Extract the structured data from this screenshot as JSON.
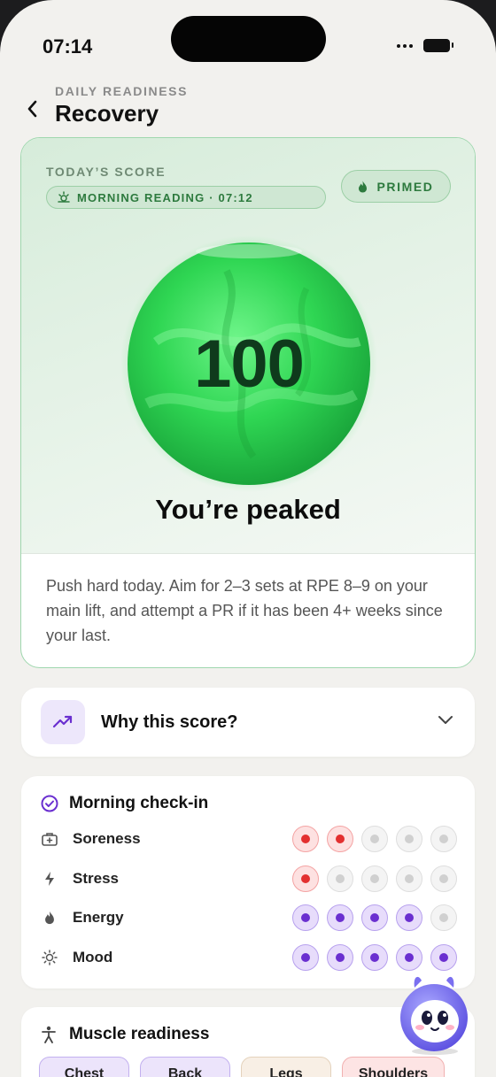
{
  "status": {
    "time": "07:14"
  },
  "header": {
    "eyebrow": "DAILY READINESS",
    "title": "Recovery"
  },
  "score_card": {
    "label": "TODAY’S SCORE",
    "reading_pill": "MORNING READING · 07:12",
    "badge": "PRIMED",
    "score": "100",
    "headline": "You’re peaked",
    "advice": "Push hard today. Aim for 2–3 sets at RPE 8–9 on your main lift, and attempt a PR if it has been 4+ weeks since your last.",
    "accent_color": "#2d7a3e",
    "orb_color": "#3ddb5c"
  },
  "why_card": {
    "title": "Why this score?",
    "icon": "trend-up-icon",
    "expanded": false
  },
  "checkin": {
    "title": "Morning check-in",
    "metrics": [
      {
        "label": "Soreness",
        "icon": "first-aid-icon",
        "level": 2,
        "max": 5,
        "tone": "red"
      },
      {
        "label": "Stress",
        "icon": "bolt-icon",
        "level": 1,
        "max": 5,
        "tone": "red"
      },
      {
        "label": "Energy",
        "icon": "flame-icon",
        "level": 4,
        "max": 5,
        "tone": "purple"
      },
      {
        "label": "Mood",
        "icon": "sun-icon",
        "level": 5,
        "max": 5,
        "tone": "purple"
      }
    ]
  },
  "muscle": {
    "title": "Muscle readiness",
    "chips": [
      {
        "label": "Chest",
        "tone": "purple"
      },
      {
        "label": "Back",
        "tone": "purple"
      },
      {
        "label": "Legs",
        "tone": "beige"
      },
      {
        "label": "Shoulders",
        "tone": "pink"
      }
    ]
  },
  "colors": {
    "red": "#e33030",
    "purple": "#6a2fd0",
    "green": "#2d7a3e"
  }
}
